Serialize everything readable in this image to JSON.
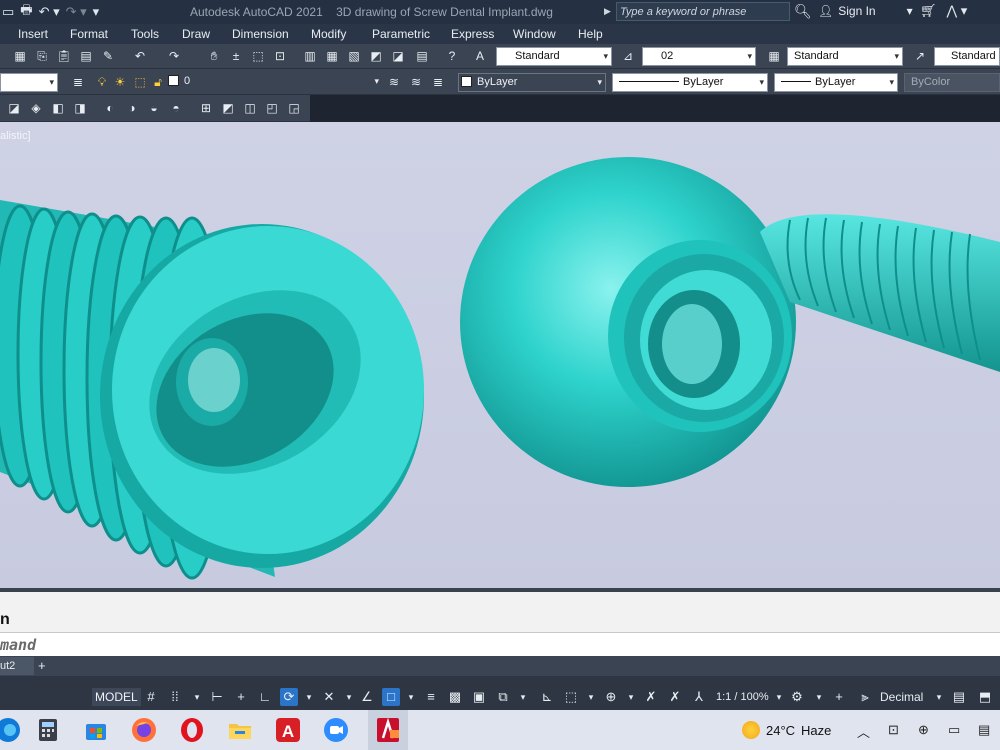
{
  "titlebar": {
    "app_title": "Autodesk AutoCAD 2021",
    "file_title": "3D drawing  of Screw Dental Implant.dwg",
    "search_placeholder": "Type a keyword or phrase",
    "signin_label": "Sign In"
  },
  "menu": {
    "items": [
      "Insert",
      "Format",
      "Tools",
      "Draw",
      "Dimension",
      "Modify",
      "Parametric",
      "Express",
      "Window",
      "Help"
    ]
  },
  "toolbar1": {
    "text_style": "Standard",
    "dim_style": "02",
    "table_style": "Standard",
    "multileader_style": "Standard"
  },
  "toolbar2": {
    "layer": "0",
    "color": "ByLayer",
    "linetype": "ByLayer",
    "lineweight": "ByLayer",
    "plotstyle": "ByColor"
  },
  "viewport": {
    "label": "alistic]"
  },
  "command": {
    "history_text": "n",
    "input_placeholder": "mand"
  },
  "tabs": {
    "layout_tab": "ut2",
    "add": "+"
  },
  "statusbar": {
    "model_label": "MODEL",
    "scale_label": "1:1 / 100%",
    "units_label": "Decimal"
  },
  "taskbar": {
    "temperature": "24°C",
    "weather": "Haze",
    "colors": {
      "chrome": "#ff7139",
      "opera": "#e0131e",
      "folder": "#f6c342",
      "acad": "#d71f26"
    }
  },
  "model_color": "#2fc9c4"
}
